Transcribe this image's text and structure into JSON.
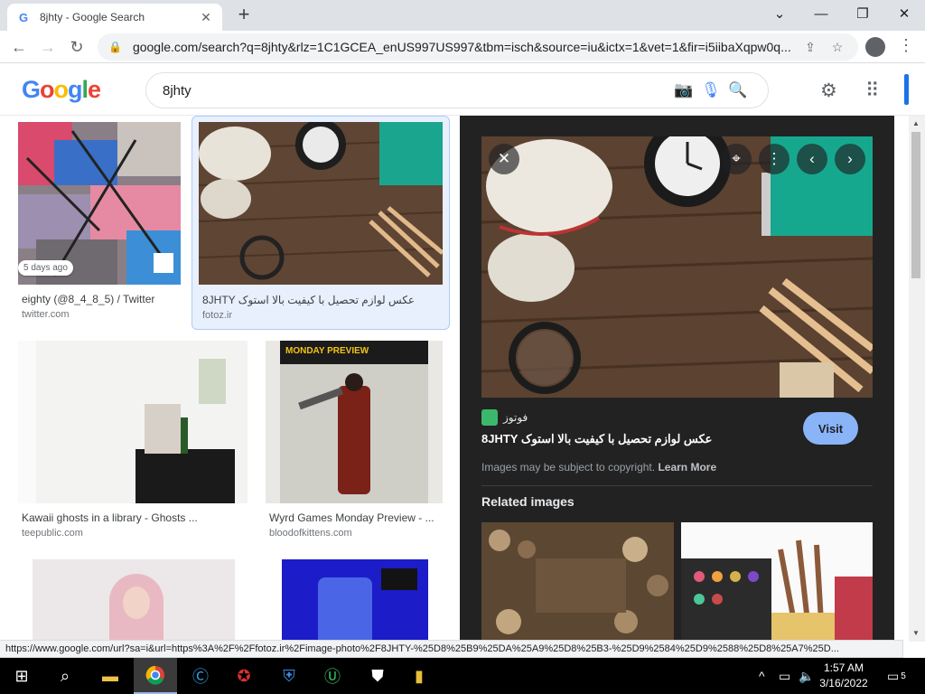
{
  "browser": {
    "tab_title": "8jhty - Google Search",
    "tab_favicon": "G",
    "url": "google.com/search?q=8jhty&rlz=1C1GCEA_enUS997US997&tbm=isch&source=iu&ictx=1&vet=1&fir=i5iibaXqpw0q...",
    "status_url": "https://www.google.com/url?sa=i&url=https%3A%2F%2Ffotoz.ir%2Fimage-photo%2F8JHTY-%25D8%25B9%25DA%25A9%25D8%25B3-%25D9%2584%25D9%2588%25D8%25A7%25D..."
  },
  "google": {
    "logo": [
      "G",
      "o",
      "o",
      "g",
      "l",
      "e"
    ],
    "logo_colors": [
      "#4285f4",
      "#ea4335",
      "#fbbc05",
      "#4285f4",
      "#34a853",
      "#ea4335"
    ],
    "query": "8jhty"
  },
  "results": [
    {
      "caption": "eighty (@8_4_8_5) / Twitter",
      "source": "twitter.com",
      "badge": "5 days ago"
    },
    {
      "caption": "8JHTY عکس لوازم تحصیل با کیفیت بالا استوک",
      "source": "fotoz.ir"
    },
    {
      "caption": "Kawaii ghosts in a library - Ghosts ...",
      "source": "teepublic.com"
    },
    {
      "caption": "Wyrd Games Monday Preview - ...",
      "source": "bloodofkittens.com"
    }
  ],
  "preview": {
    "site": "فوتوز",
    "title": "8JHTY عکس لوازم تحصیل با کیفیت بالا استوک",
    "visit_label": "Visit",
    "copyright": "Images may be subject to copyright.",
    "learn_more": "Learn More",
    "related_title": "Related images"
  },
  "monday_preview_banner": "MONDAY PREVIEW",
  "taskbar": {
    "time": "1:57 AM",
    "date": "3/16/2022",
    "notifications": "5"
  },
  "icons": [
    "chrome-favicon",
    "close-tab-icon",
    "new-tab-icon",
    "minimize-icon",
    "restore-icon",
    "close-window-icon",
    "back-icon",
    "forward-icon",
    "reload-icon",
    "lock-icon",
    "share-icon",
    "bookmark-star-icon",
    "profile-icon",
    "menu-icon",
    "camera-icon",
    "mic-icon",
    "search-icon",
    "settings-gear-icon",
    "apps-grid-icon",
    "windows-start-icon",
    "taskbar-search-icon",
    "file-explorer-icon",
    "chrome-icon"
  ]
}
